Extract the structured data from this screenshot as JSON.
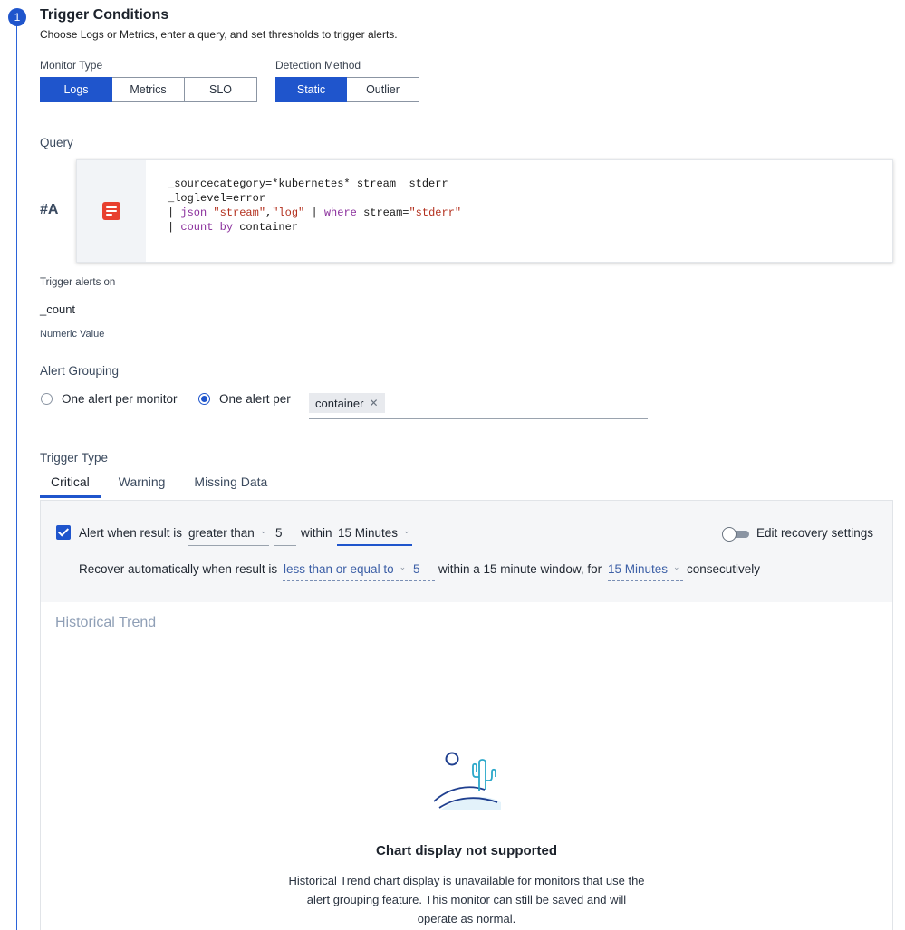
{
  "step": {
    "number": "1"
  },
  "header": {
    "title": "Trigger Conditions",
    "subtitle": "Choose Logs or Metrics, enter a query, and set thresholds to trigger alerts."
  },
  "monitor_type": {
    "label": "Monitor Type",
    "options": [
      "Logs",
      "Metrics",
      "SLO"
    ],
    "selected": "Logs"
  },
  "detection_method": {
    "label": "Detection Method",
    "options": [
      "Static",
      "Outlier"
    ],
    "selected": "Static"
  },
  "query": {
    "label": "Query",
    "row_tag": "#A",
    "icon": "logs-query-icon",
    "lines": [
      "_sourcecategory=*kubernetes* stream  stderr",
      "_loglevel=error",
      "| json \"stream\",\"log\" | where stream=\"stderr\"",
      "| count by container"
    ]
  },
  "trigger_on": {
    "label": "Trigger alerts on",
    "value": "_count",
    "helper": "Numeric Value"
  },
  "alert_grouping": {
    "label": "Alert Grouping",
    "option_monitor": "One alert per monitor",
    "option_per": "One alert per",
    "selected": "One alert per",
    "chips": [
      "container"
    ]
  },
  "trigger_type": {
    "label": "Trigger Type",
    "tabs": [
      "Critical",
      "Warning",
      "Missing Data"
    ],
    "active_tab": "Critical"
  },
  "critical": {
    "alert_checked": true,
    "alert_prefix": "Alert when result is",
    "operator": "greater than",
    "threshold": "5",
    "within_label": "within",
    "window": "15 Minutes",
    "recovery_toggle_label": "Edit recovery settings",
    "recovery_toggle_on": false,
    "recover_prefix": "Recover automatically when result is",
    "recover_operator": "less than or equal to",
    "recover_threshold": "5",
    "recover_middle": "within a 15 minute window, for",
    "recover_window": "15 Minutes",
    "recover_suffix": "consecutively"
  },
  "historical_trend": {
    "title": "Historical Trend",
    "illustration": "desert-cactus-illustration",
    "empty_title": "Chart display not supported",
    "empty_description": "Historical Trend chart display is unavailable for monitors that use the alert grouping feature. This monitor can still be saved and will operate as normal."
  },
  "colors": {
    "primary": "#1f55cc",
    "query_icon": "#e8402f"
  }
}
